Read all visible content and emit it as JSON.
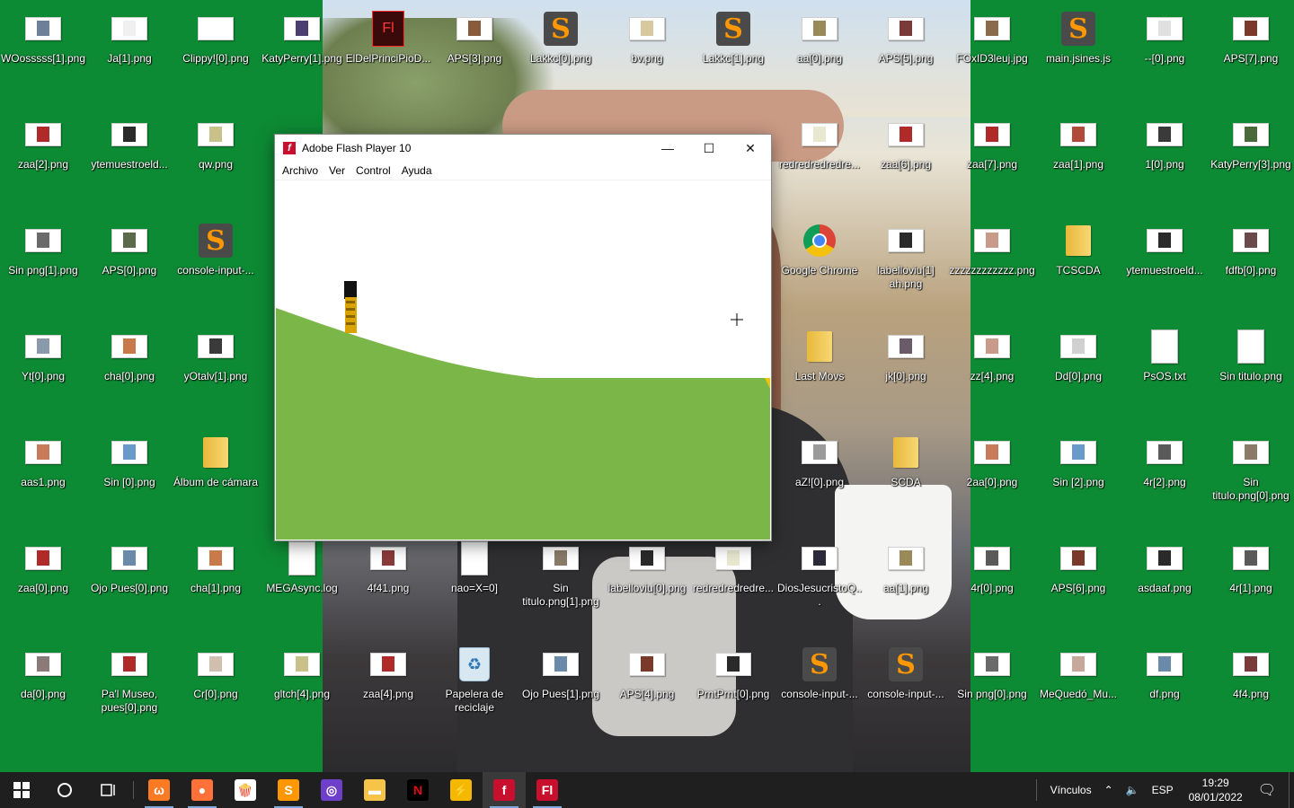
{
  "desktop": {
    "rows": [
      [
        {
          "label": "WOosssss[1].png",
          "icon": "image-file-icon",
          "color": "#6d7f9a"
        },
        {
          "label": "Ja[1].png",
          "icon": "image-file-icon",
          "color": "#f0f0f0"
        },
        {
          "label": "Clippy![0].png",
          "icon": "image-file-icon",
          "color": "#ffffff"
        },
        {
          "label": "KatyPerry[1].png",
          "icon": "image-file-icon",
          "color": "#4a3f6e"
        },
        {
          "label": "ElDelPrinciPioD...",
          "icon": "flash-fla-icon",
          "color": "#c8102e"
        },
        {
          "label": "APS[3].png",
          "icon": "image-file-icon",
          "color": "#8a5a3c"
        },
        {
          "label": "Lakkc[0].png",
          "icon": "sublime-icon",
          "color": "#ff9800"
        },
        {
          "label": "bv.png",
          "icon": "image-file-icon",
          "color": "#d9c9a0"
        },
        {
          "label": "Lakkc[1].png",
          "icon": "sublime-icon",
          "color": "#ff9800"
        },
        {
          "label": "aa[0].png",
          "icon": "image-file-icon",
          "color": "#9a8a5a"
        },
        {
          "label": "APS[5].png",
          "icon": "image-file-icon",
          "color": "#7a3a3a"
        },
        {
          "label": "FOxID3leuj.jpg",
          "icon": "image-file-icon",
          "color": "#8a6a4a"
        },
        {
          "label": "main.jsines.js",
          "icon": "sublime-icon",
          "color": "#ff9800"
        },
        {
          "label": "--[0].png",
          "icon": "image-file-icon",
          "color": "#e0e0e0"
        },
        {
          "label": "APS[7].png",
          "icon": "image-file-icon",
          "color": "#7a3a2a"
        }
      ],
      [
        {
          "label": "zaa[2].png",
          "icon": "image-file-icon",
          "color": "#b02a2a"
        },
        {
          "label": "ytemuestroeld...",
          "icon": "image-file-icon",
          "color": "#2a2a2a"
        },
        {
          "label": "qw.png",
          "icon": "image-file-icon",
          "color": "#c8c28a"
        },
        {
          "label": "",
          "icon": "none",
          "color": ""
        },
        {
          "label": "",
          "icon": "none",
          "color": ""
        },
        {
          "label": "",
          "icon": "none",
          "color": ""
        },
        {
          "label": "",
          "icon": "none",
          "color": ""
        },
        {
          "label": "",
          "icon": "none",
          "color": ""
        },
        {
          "label": "",
          "icon": "none",
          "color": ""
        },
        {
          "label": "redredredredre...",
          "icon": "image-file-icon",
          "color": "#e8e8d0"
        },
        {
          "label": "zaa[6].png",
          "icon": "image-file-icon",
          "color": "#b02a2a"
        },
        {
          "label": "zaa[7].png",
          "icon": "image-file-icon",
          "color": "#b02a2a"
        },
        {
          "label": "zaa[1].png",
          "icon": "image-file-icon",
          "color": "#b04a3a"
        },
        {
          "label": "1[0].png",
          "icon": "image-file-icon",
          "color": "#3a3a3a"
        },
        {
          "label": "KatyPerry[3].png",
          "icon": "image-file-icon",
          "color": "#4a6a3a"
        }
      ],
      [
        {
          "label": "Sin png[1].png",
          "icon": "image-file-icon",
          "color": "#6a6a6a"
        },
        {
          "label": "APS[0].png",
          "icon": "image-file-icon",
          "color": "#5a6a4a"
        },
        {
          "label": "console-input-...",
          "icon": "sublime-icon",
          "color": "#ff9800"
        },
        {
          "label": "",
          "icon": "none",
          "color": ""
        },
        {
          "label": "",
          "icon": "none",
          "color": ""
        },
        {
          "label": "",
          "icon": "none",
          "color": ""
        },
        {
          "label": "",
          "icon": "none",
          "color": ""
        },
        {
          "label": "",
          "icon": "none",
          "color": ""
        },
        {
          "label": "",
          "icon": "none",
          "color": ""
        },
        {
          "label": "Google Chrome",
          "icon": "chrome-icon",
          "color": ""
        },
        {
          "label": "labelloviu[1] ah.png",
          "icon": "image-file-icon",
          "color": "#2a2a2a"
        },
        {
          "label": "zzzzzzzzzzzz.png",
          "icon": "image-file-icon",
          "color": "#c89a8a"
        },
        {
          "label": "TCSCDA",
          "icon": "folder-icon",
          "color": ""
        },
        {
          "label": "ytemuestroeld...",
          "icon": "image-file-icon",
          "color": "#2a2a2a"
        },
        {
          "label": "fdfb[0].png",
          "icon": "image-file-icon",
          "color": "#6a4a4a"
        }
      ],
      [
        {
          "label": "Yt[0].png",
          "icon": "image-file-icon",
          "color": "#8a9aaa"
        },
        {
          "label": "cha[0].png",
          "icon": "image-file-icon",
          "color": "#c87a4a"
        },
        {
          "label": "yOtalv[1].png",
          "icon": "image-file-icon",
          "color": "#3a3a3a"
        },
        {
          "label": "",
          "icon": "none",
          "color": ""
        },
        {
          "label": "",
          "icon": "none",
          "color": ""
        },
        {
          "label": "",
          "icon": "none",
          "color": ""
        },
        {
          "label": "",
          "icon": "none",
          "color": ""
        },
        {
          "label": "",
          "icon": "none",
          "color": ""
        },
        {
          "label": "",
          "icon": "none",
          "color": ""
        },
        {
          "label": "Last Movs",
          "icon": "folder-icon",
          "color": ""
        },
        {
          "label": "jk[0].png",
          "icon": "image-file-icon",
          "color": "#6a5a6a"
        },
        {
          "label": "zz[4].png",
          "icon": "image-file-icon",
          "color": "#c89a8a"
        },
        {
          "label": "Dd[0].png",
          "icon": "image-file-icon",
          "color": "#d0d0d0"
        },
        {
          "label": "PsOS.txt",
          "icon": "text-file-icon",
          "color": ""
        },
        {
          "label": "Sin titulo.png",
          "icon": "blank-file-icon",
          "color": "#ffffff"
        }
      ],
      [
        {
          "label": "aas1.png",
          "icon": "image-file-icon",
          "color": "#c87a5a"
        },
        {
          "label": "Sin [0].png",
          "icon": "image-file-icon",
          "color": "#6a9aca"
        },
        {
          "label": "Álbum de cámara",
          "icon": "folder-icon",
          "color": ""
        },
        {
          "label": "",
          "icon": "none",
          "color": ""
        },
        {
          "label": "",
          "icon": "none",
          "color": ""
        },
        {
          "label": "",
          "icon": "none",
          "color": ""
        },
        {
          "label": "",
          "icon": "none",
          "color": ""
        },
        {
          "label": "",
          "icon": "none",
          "color": ""
        },
        {
          "label": "",
          "icon": "none",
          "color": ""
        },
        {
          "label": "aZ![0].png",
          "icon": "image-file-icon",
          "color": "#9a9a9a"
        },
        {
          "label": "SCDA",
          "icon": "folder-icon",
          "color": ""
        },
        {
          "label": "2aa[0].png",
          "icon": "image-file-icon",
          "color": "#c87a5a"
        },
        {
          "label": "Sin [2].png",
          "icon": "image-file-icon",
          "color": "#6a9aca"
        },
        {
          "label": "4r[2].png",
          "icon": "image-file-icon",
          "color": "#5a5a5a"
        },
        {
          "label": "Sin titulo.png[0].png",
          "icon": "image-file-icon",
          "color": "#8a7a6a"
        }
      ],
      [
        {
          "label": "zaa[0].png",
          "icon": "image-file-icon",
          "color": "#b02a2a"
        },
        {
          "label": "Ojo Pues[0].png",
          "icon": "image-file-icon",
          "color": "#6a8aaa"
        },
        {
          "label": "cha[1].png",
          "icon": "image-file-icon",
          "color": "#c87a4a"
        },
        {
          "label": "MEGAsync.log",
          "icon": "text-file-icon",
          "color": ""
        },
        {
          "label": "4f41.png",
          "icon": "image-file-icon",
          "color": "#8a3a3a"
        },
        {
          "label": "nao=X=0]",
          "icon": "blank-file-icon",
          "color": "#ffffff"
        },
        {
          "label": "Sin titulo.png[1].png",
          "icon": "image-file-icon",
          "color": "#8a7a6a"
        },
        {
          "label": "labelloviu[0].png",
          "icon": "image-file-icon",
          "color": "#2a2a2a"
        },
        {
          "label": "redredredredre...",
          "icon": "image-file-icon",
          "color": "#e8e8d0"
        },
        {
          "label": "DiosJesucristoQ...",
          "icon": "image-file-icon",
          "color": "#2a2a3a"
        },
        {
          "label": "aa[1].png",
          "icon": "image-file-icon",
          "color": "#9a8a5a"
        },
        {
          "label": "4r[0].png",
          "icon": "image-file-icon",
          "color": "#5a5a5a"
        },
        {
          "label": "APS[6].png",
          "icon": "image-file-icon",
          "color": "#7a3a2a"
        },
        {
          "label": "asdaaf.png",
          "icon": "image-file-icon",
          "color": "#2a2a2a"
        },
        {
          "label": "4r[1].png",
          "icon": "image-file-icon",
          "color": "#5a5a5a"
        }
      ],
      [
        {
          "label": "da[0].png",
          "icon": "image-file-icon",
          "color": "#8a7a7a"
        },
        {
          "label": "Pa'l Museo, pues[0].png",
          "icon": "image-file-icon",
          "color": "#b02a2a"
        },
        {
          "label": "Cr[0].png",
          "icon": "image-file-icon",
          "color": "#d0c0b0"
        },
        {
          "label": "gltch[4].png",
          "icon": "image-file-icon",
          "color": "#c8c28a"
        },
        {
          "label": "zaa[4].png",
          "icon": "image-file-icon",
          "color": "#b02a2a"
        },
        {
          "label": "Papelera de reciclaje",
          "icon": "recycle-bin-icon",
          "color": ""
        },
        {
          "label": "Ojo Pues[1].png",
          "icon": "image-file-icon",
          "color": "#6a8aaa"
        },
        {
          "label": "APS[4].png",
          "icon": "image-file-icon",
          "color": "#7a3a2a"
        },
        {
          "label": "PrntPrnt[0].png",
          "icon": "image-file-icon",
          "color": "#2a2a2a"
        },
        {
          "label": "console-input-...",
          "icon": "sublime-icon",
          "color": "#ff9800"
        },
        {
          "label": "console-input-...",
          "icon": "sublime-icon",
          "color": "#ff9800"
        },
        {
          "label": "Sin png[0].png",
          "icon": "image-file-icon",
          "color": "#6a6a6a"
        },
        {
          "label": "MeQuedó_Mu...",
          "icon": "image-file-icon",
          "color": "#c8a89a"
        },
        {
          "label": "df.png",
          "icon": "image-file-icon",
          "color": "#6a8aaa"
        },
        {
          "label": "4f4.png",
          "icon": "image-file-icon",
          "color": "#7a3a3a"
        }
      ]
    ]
  },
  "window": {
    "title": "Adobe Flash Player 10",
    "menu": [
      "Archivo",
      "Ver",
      "Control",
      "Ayuda"
    ],
    "minimize_glyph": "—",
    "maximize_glyph": "☐",
    "close_glyph": "✕",
    "ground_color": "#7ab648",
    "cursor_glyph": "+"
  },
  "taskbar": {
    "pinned": [
      {
        "name": "xampp-icon",
        "glyph": "ω",
        "color": "#fb7a24",
        "running": true
      },
      {
        "name": "firefox-icon",
        "glyph": "●",
        "color": "#ff7139",
        "running": true
      },
      {
        "name": "popcorn-icon",
        "glyph": "🍿",
        "color": "#ffffff",
        "running": false
      },
      {
        "name": "sublime-taskbar-icon",
        "glyph": "S",
        "color": "#ff9800",
        "running": true
      },
      {
        "name": "github-icon",
        "glyph": "◎",
        "color": "#6e40c9",
        "running": false
      },
      {
        "name": "file-explorer-icon",
        "glyph": "▬",
        "color": "#f7c44a",
        "running": false
      },
      {
        "name": "netflix-icon",
        "glyph": "N",
        "color": "#e50914",
        "running": false
      },
      {
        "name": "winamp-icon",
        "glyph": "⚡",
        "color": "#f5b800",
        "running": false
      },
      {
        "name": "flash-player-icon",
        "glyph": "f",
        "color": "#c8102e",
        "running": true
      },
      {
        "name": "flash-pro-icon",
        "glyph": "Fl",
        "color": "#c8102e",
        "running": true
      }
    ],
    "links_label": "Vínculos",
    "language": "ESP",
    "time": "19:29",
    "date": "08/01/2022"
  }
}
